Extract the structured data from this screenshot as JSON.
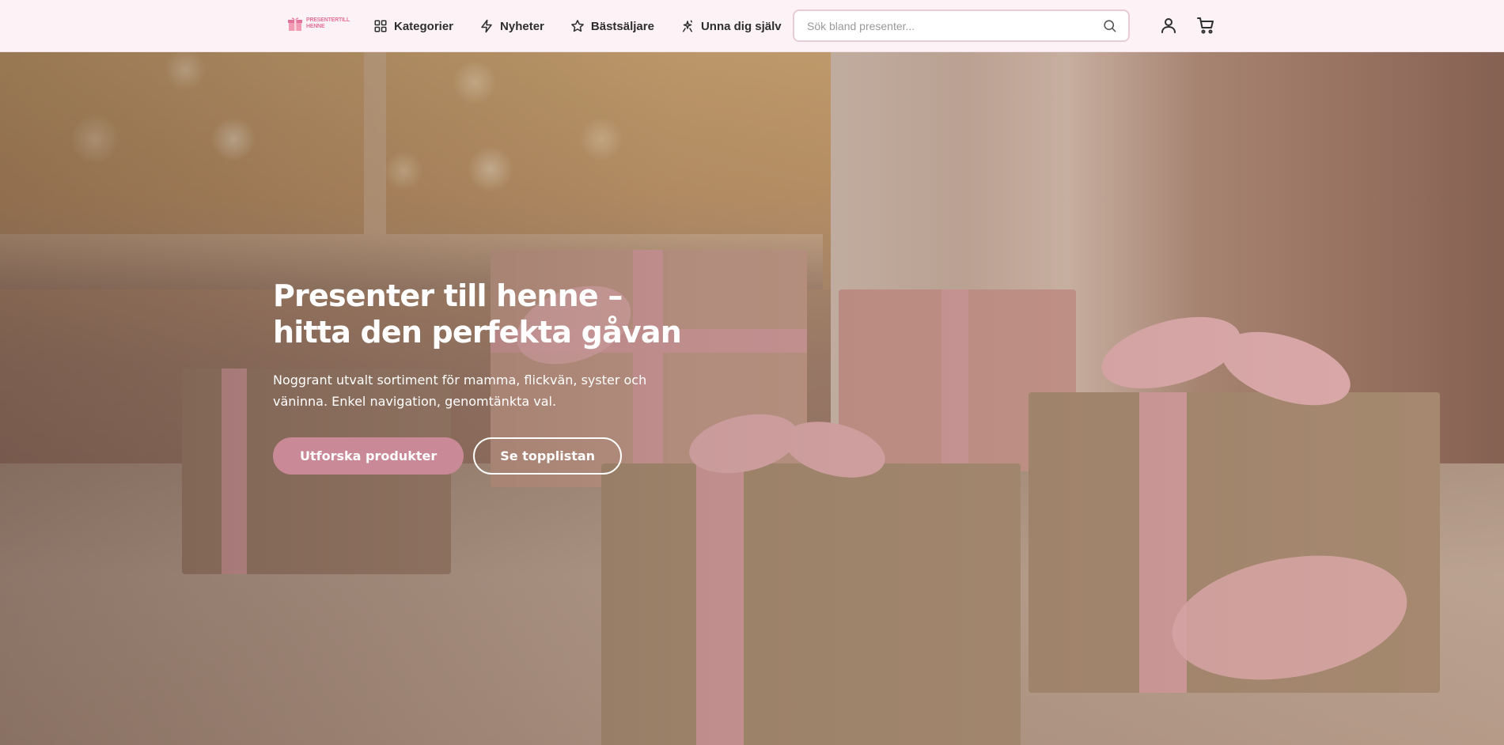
{
  "logo": {
    "line1": "PRESENTERTILL",
    "line2": "HENNE"
  },
  "nav": {
    "items": [
      {
        "label": "Kategorier",
        "icon": "grid-icon"
      },
      {
        "label": "Nyheter",
        "icon": "lightning-icon"
      },
      {
        "label": "Bästsäljare",
        "icon": "star-icon"
      },
      {
        "label": "Unna dig själv",
        "icon": "sparkle-person-icon"
      }
    ]
  },
  "search": {
    "placeholder": "Sök bland presenter...",
    "value": ""
  },
  "header_icons": {
    "account": "user-icon",
    "cart": "cart-icon"
  },
  "hero": {
    "title": "Presenter till henne – hitta den perfekta gåvan",
    "subtitle": "Noggrant utvalt sortiment för mamma, flickvän, syster och väninna. Enkel navigation, genomtänkta val.",
    "primary_button": "Utforska produkter",
    "secondary_button": "Se topplistan"
  },
  "colors": {
    "header_bg": "#fdf2f5",
    "brand_pink": "#e3739a",
    "button_pink": "#c98997",
    "search_border": "#e7cdd3"
  }
}
